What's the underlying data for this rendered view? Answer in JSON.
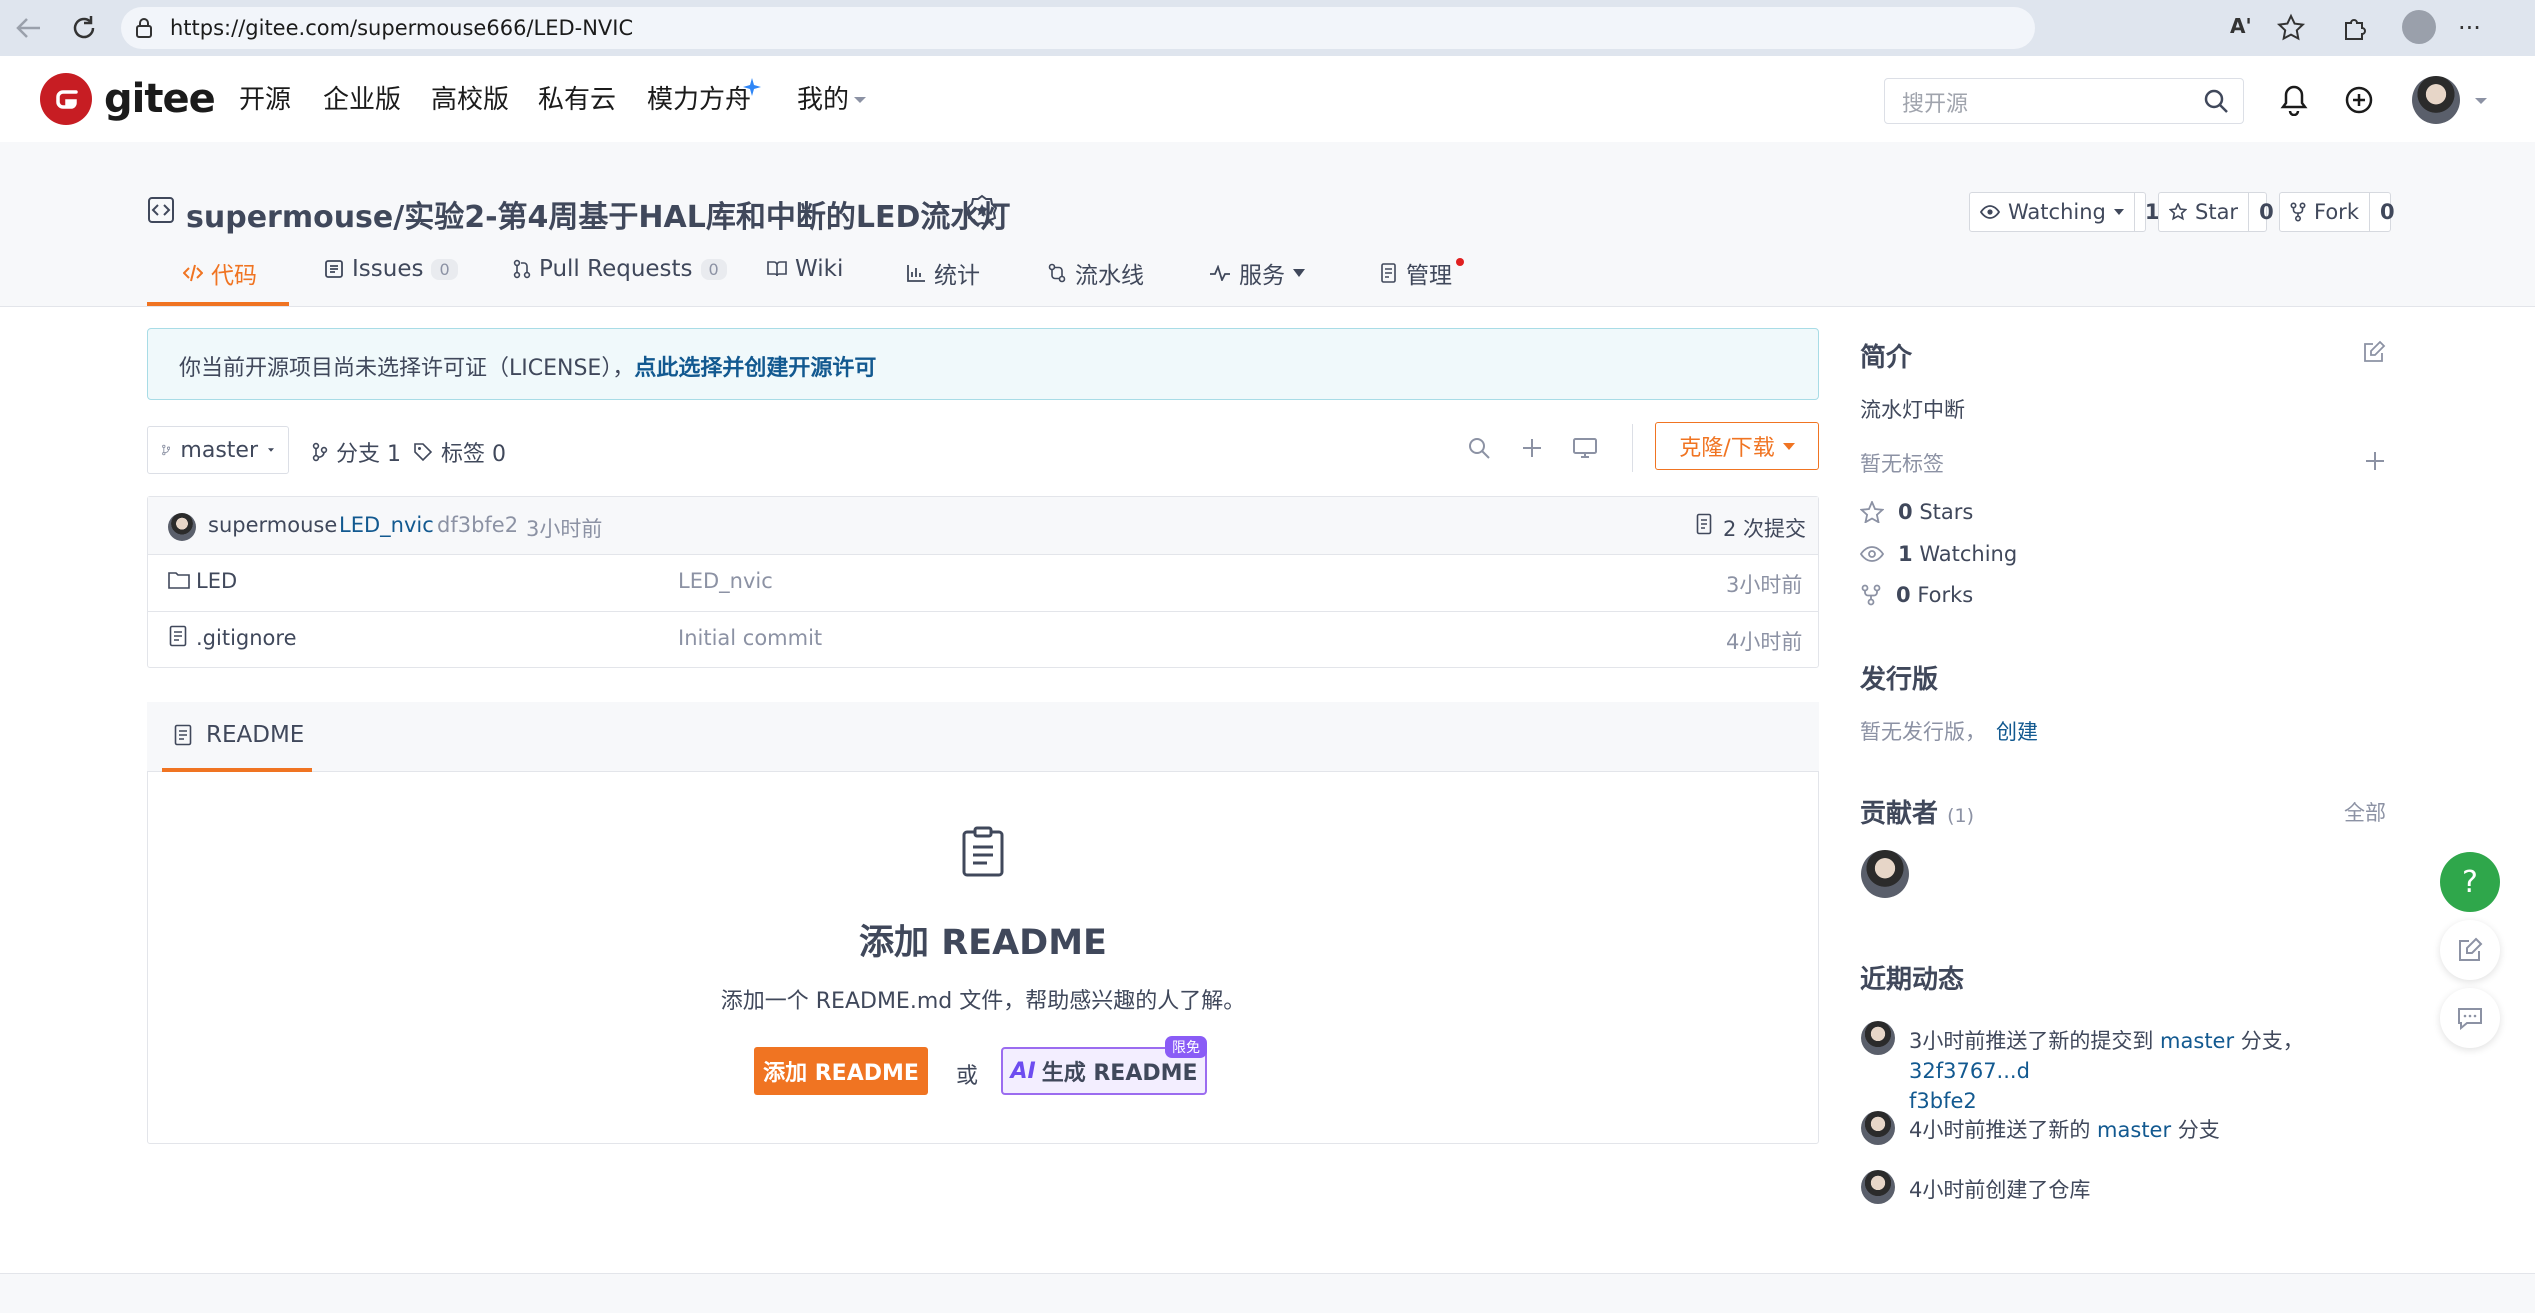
{
  "browser": {
    "url": "https://gitee.com/supermouse666/LED-NVIC"
  },
  "nav": {
    "brand": "gitee",
    "links": [
      "开源",
      "企业版",
      "高校版",
      "私有云",
      "模力方舟",
      "我的"
    ],
    "search_placeholder": "搜开源"
  },
  "repo": {
    "title": "supermouse/实验2-第4周基于HAL库和中断的LED流水灯",
    "watching_label": "Watching",
    "watching_count": "1",
    "star_label": "Star",
    "star_count": "0",
    "fork_label": "Fork",
    "fork_count": "0"
  },
  "tabs": [
    {
      "label": "代码"
    },
    {
      "label": "Issues",
      "count": "0"
    },
    {
      "label": "Pull Requests",
      "count": "0"
    },
    {
      "label": "Wiki"
    },
    {
      "label": "统计"
    },
    {
      "label": "流水线"
    },
    {
      "label": "服务"
    },
    {
      "label": "管理"
    }
  ],
  "license_notice": {
    "text": "你当前开源项目尚未选择许可证（LICENSE），",
    "link": "点此选择并创建开源许可"
  },
  "toolbar": {
    "branch": "master",
    "branches": "分支 1",
    "tags": "标签 0",
    "clone": "克隆/下载"
  },
  "commit": {
    "author": "supermouse",
    "message": "LED_nvic",
    "hash": "df3bfe2",
    "time": "3小时前",
    "commits": "2 次提交"
  },
  "files": [
    {
      "name": "LED",
      "type": "folder",
      "message": "LED_nvic",
      "time": "3小时前"
    },
    {
      "name": ".gitignore",
      "type": "file",
      "message": "Initial commit",
      "time": "4小时前"
    }
  ],
  "readme": {
    "tab": "README",
    "title": "添加 README",
    "desc": "添加一个 README.md 文件，帮助感兴趣的人了解。",
    "add_button": "添加 README",
    "or": "或",
    "ai_button": "生成 README",
    "ai_prefix": "AI",
    "ai_badge": "限免"
  },
  "sidebar": {
    "intro_title": "简介",
    "intro_text": "流水灯中断",
    "no_tags": "暂无标签",
    "stars": {
      "count": "0",
      "label": "Stars"
    },
    "watching": {
      "count": "1",
      "label": "Watching"
    },
    "forks": {
      "count": "0",
      "label": "Forks"
    },
    "release_title": "发行版",
    "release_text": "暂无发行版，",
    "release_link": "创建",
    "contrib_title": "贡献者",
    "contrib_count": "(1)",
    "contrib_all": "全部",
    "activity_title": "近期动态",
    "activity": [
      {
        "pre": "3小时前推送了新的提交到 ",
        "link": "master",
        "mid": " 分支，",
        "link2": "32f3767...d",
        "link3": "f3bfe2"
      },
      {
        "pre": "4小时前推送了新的 ",
        "link": "master",
        "mid": " 分支"
      },
      {
        "pre": "4小时前创建了仓库"
      }
    ]
  },
  "colors": {
    "accent": "#f07422",
    "link": "#125990",
    "help": "#2fa74b"
  }
}
